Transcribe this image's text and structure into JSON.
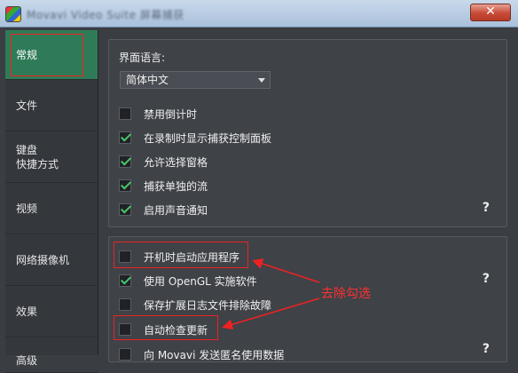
{
  "window": {
    "title": "Movavi Video Suite 屏幕捕获",
    "close_glyph": "✕"
  },
  "sidebar": {
    "items": [
      {
        "label": "常规"
      },
      {
        "label": "文件"
      },
      {
        "label": "键盘\n快捷方式"
      },
      {
        "label": "视频"
      },
      {
        "label": "网络摄像机"
      },
      {
        "label": "效果"
      },
      {
        "label": "高级"
      }
    ]
  },
  "general": {
    "language_label": "界面语言:",
    "language_value": "简体中文",
    "options": [
      {
        "label": "禁用倒计时",
        "checked": false
      },
      {
        "label": "在录制时显示捕获控制面板",
        "checked": true
      },
      {
        "label": "允许选择窗格",
        "checked": true
      },
      {
        "label": "捕获单独的流",
        "checked": true
      },
      {
        "label": "启用声音通知",
        "checked": true
      }
    ],
    "help": "?"
  },
  "advanced": {
    "options": [
      {
        "label": "开机时启动应用程序",
        "checked": false
      },
      {
        "label": "使用 OpenGL 实施软件",
        "checked": true
      },
      {
        "label": "保存扩展日志文件排除故障",
        "checked": false
      },
      {
        "label": "自动检查更新",
        "checked": false
      },
      {
        "label": "向 Movavi 发送匿名使用数据",
        "checked": false
      }
    ],
    "help": "?"
  },
  "annotation": {
    "text": "去除勾选",
    "color": "#ff3030"
  }
}
